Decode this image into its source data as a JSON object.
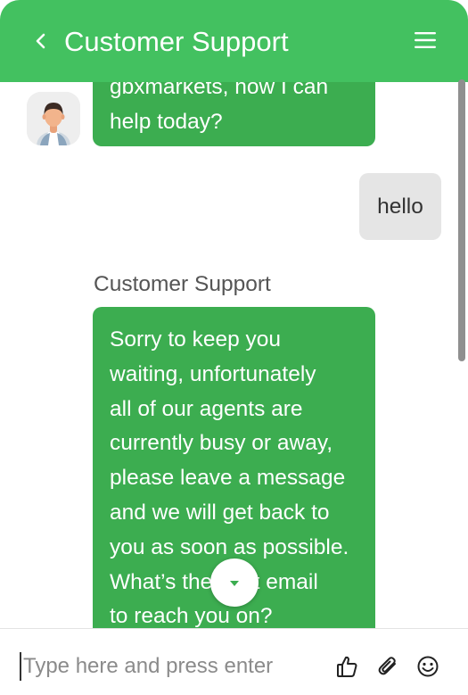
{
  "header": {
    "title": "Customer Support",
    "back_icon": "chevron-left-icon",
    "menu_icon": "hamburger-menu-icon"
  },
  "messages": [
    {
      "from": "agent",
      "lines": [
        "gbxmarkets, how I can",
        "help today?"
      ]
    },
    {
      "from": "user",
      "text": "hello"
    },
    {
      "from": "agent",
      "sender": "Customer Support",
      "lines": [
        "Sorry to keep you",
        "waiting, unfortunately",
        "all of our agents are",
        "currently busy or away,",
        "please leave a message",
        "and we will get back to",
        "you as soon as possible.",
        "What’s the best email",
        "to reach you on?"
      ]
    }
  ],
  "composer": {
    "placeholder": "Type here and press enter",
    "value": "",
    "icons": [
      "thumbs-up-icon",
      "paperclip-icon",
      "smiley-icon"
    ]
  },
  "scroll_down_icon": "caret-down-icon",
  "colors": {
    "header": "#43c160",
    "agent_bubble": "#3cad50",
    "user_bubble": "#e5e5e5",
    "text_on_green": "#ffffff"
  }
}
